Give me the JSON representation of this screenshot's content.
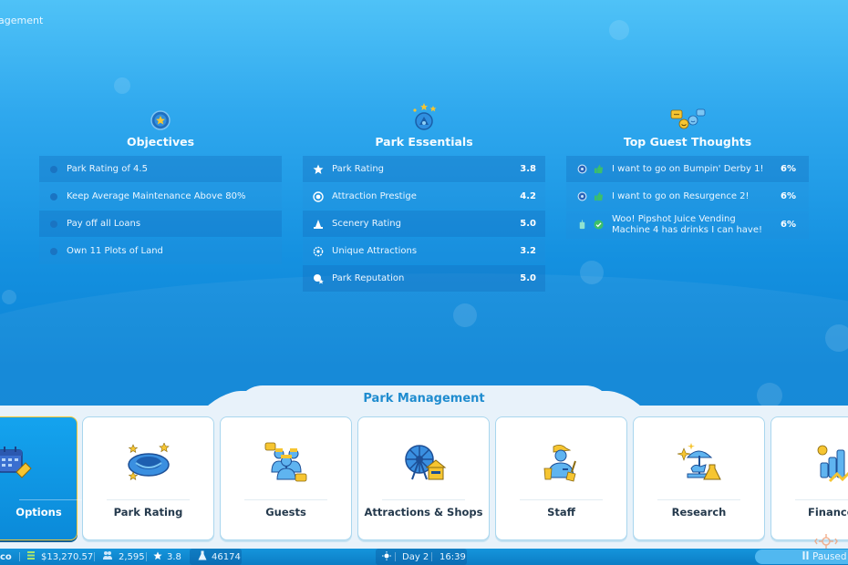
{
  "window": {
    "title": "Park Management"
  },
  "top_title_partial": "agement",
  "objectives": {
    "icon": "objective-star-badge-icon",
    "title": "Objectives",
    "items": [
      {
        "label": "Park Rating of 4.5"
      },
      {
        "label": "Keep Average Maintenance Above 80%"
      },
      {
        "label": "Pay off all Loans"
      },
      {
        "label": "Own 11 Plots of Land"
      }
    ]
  },
  "essentials": {
    "icon": "park-essentials-badge-icon",
    "title": "Park Essentials",
    "items": [
      {
        "icon": "star-icon",
        "label": "Park Rating",
        "value": "3.8"
      },
      {
        "icon": "prestige-icon",
        "label": "Attraction Prestige",
        "value": "4.2"
      },
      {
        "icon": "scenery-icon",
        "label": "Scenery Rating",
        "value": "5.0"
      },
      {
        "icon": "unique-attractions-icon",
        "label": "Unique Attractions",
        "value": "3.2"
      },
      {
        "icon": "reputation-icon",
        "label": "Park Reputation",
        "value": "5.0"
      }
    ]
  },
  "thoughts": {
    "icon": "guest-thoughts-icon",
    "title": "Top Guest Thoughts",
    "items": [
      {
        "icon": "ride-icon",
        "sentiment": "thumbs-up-icon",
        "label": "I want to go on Bumpin' Derby 1!",
        "value": "6%"
      },
      {
        "icon": "ride-icon",
        "sentiment": "thumbs-up-icon",
        "label": "I want to go on Resurgence 2!",
        "value": "6%"
      },
      {
        "icon": "drink-icon",
        "sentiment": "check-icon",
        "label": "Woo! Pipshot Juice Vending Machine 4 has drinks I can have!",
        "value": "6%"
      }
    ]
  },
  "management": {
    "title": "Park Management",
    "cards": [
      {
        "label": "Options",
        "icon": "calendar-ticket-icon",
        "active": true
      },
      {
        "label": "Park Rating",
        "icon": "park-rating-icon"
      },
      {
        "label": "Guests",
        "icon": "guests-icon"
      },
      {
        "label": "Attractions & Shops",
        "icon": "ferris-wheel-shop-icon"
      },
      {
        "label": "Staff",
        "icon": "staff-icon"
      },
      {
        "label": "Research",
        "icon": "research-carousel-icon"
      },
      {
        "label": "Finances",
        "icon": "finances-chart-icon"
      }
    ]
  },
  "statusbar": {
    "park_name_partial": "co",
    "money": "$13,270.57",
    "guests": "2,595",
    "rating": "3.8",
    "research_points": "46174",
    "day": "Day 2",
    "time": "16:39",
    "paused": "Paused"
  },
  "colors": {
    "accent": "#1f8ccf",
    "active_card": "#14a3ee",
    "active_border": "#f2c634",
    "card_text": "#253a4d"
  }
}
